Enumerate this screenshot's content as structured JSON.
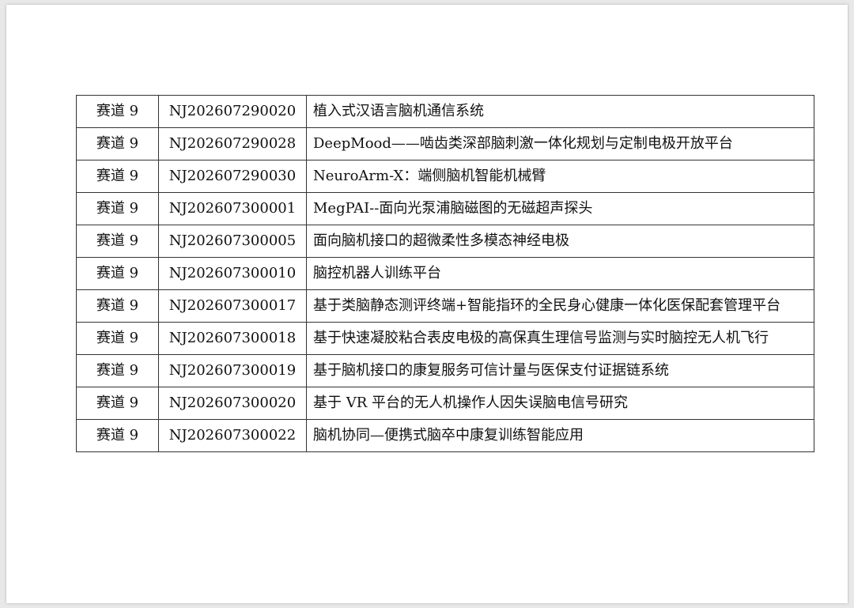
{
  "table": {
    "rows": [
      {
        "track": "赛道 9",
        "code": "NJ202607290020",
        "title": "植入式汉语言脑机通信系统"
      },
      {
        "track": "赛道 9",
        "code": "NJ202607290028",
        "title": "DeepMood——啮齿类深部脑刺激一体化规划与定制电极开放平台"
      },
      {
        "track": "赛道 9",
        "code": "NJ202607290030",
        "title": "NeuroArm-X：端侧脑机智能机械臂"
      },
      {
        "track": "赛道 9",
        "code": "NJ202607300001",
        "title": "MegPAI--面向光泵浦脑磁图的无磁超声探头"
      },
      {
        "track": "赛道 9",
        "code": "NJ202607300005",
        "title": "面向脑机接口的超微柔性多模态神经电极"
      },
      {
        "track": "赛道 9",
        "code": "NJ202607300010",
        "title": "脑控机器人训练平台"
      },
      {
        "track": "赛道 9",
        "code": "NJ202607300017",
        "title": "基于类脑静态测评终端+智能指环的全民身心健康一体化医保配套管理平台"
      },
      {
        "track": "赛道 9",
        "code": "NJ202607300018",
        "title": "基于快速凝胶粘合表皮电极的高保真生理信号监测与实时脑控无人机飞行"
      },
      {
        "track": "赛道 9",
        "code": "NJ202607300019",
        "title": "基于脑机接口的康复服务可信计量与医保支付证据链系统"
      },
      {
        "track": "赛道 9",
        "code": "NJ202607300020",
        "title": "基于 VR 平台的无人机操作人因失误脑电信号研究"
      },
      {
        "track": "赛道 9",
        "code": "NJ202607300022",
        "title": "脑机协同—便携式脑卒中康复训练智能应用"
      }
    ]
  }
}
